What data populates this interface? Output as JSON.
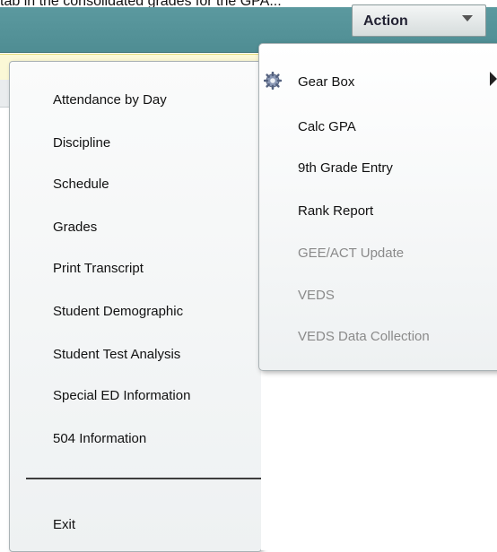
{
  "caption": "tab in the consolidated grades for the GPA...",
  "toolbar": {
    "action_label": "Action"
  },
  "left_menu": {
    "items": [
      "Attendance by Day",
      "Discipline",
      "Schedule",
      "Grades",
      "Print Transcript",
      "Student Demographic",
      "Student Test Analysis",
      "Special ED Information",
      "504 Information"
    ],
    "exit_label": "Exit"
  },
  "action_menu": {
    "gear_icon": "gear-icon",
    "items": [
      {
        "label": "Gear Box",
        "enabled": true,
        "has_submenu": true
      },
      {
        "label": "Calc GPA",
        "enabled": true
      },
      {
        "label": "9th Grade Entry",
        "enabled": true
      },
      {
        "label": "Rank Report",
        "enabled": true
      },
      {
        "label": "GEE/ACT Update",
        "enabled": false
      },
      {
        "label": "VEDS",
        "enabled": false
      },
      {
        "label": "VEDS Data Collection",
        "enabled": false
      }
    ],
    "colors": {
      "enabled": "#111111",
      "disabled": "#8a8a8a"
    }
  }
}
